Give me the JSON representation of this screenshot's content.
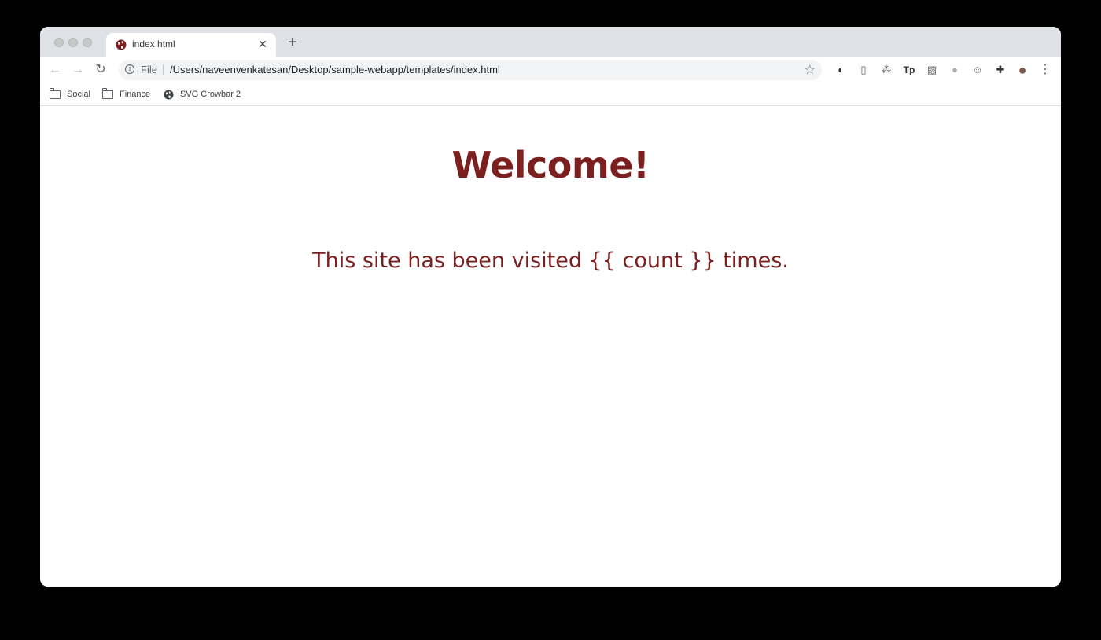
{
  "browser": {
    "tab": {
      "title": "index.html",
      "favicon": "globe-icon",
      "close_glyph": "✕"
    },
    "new_tab_glyph": "+",
    "nav": {
      "back_glyph": "←",
      "forward_glyph": "→",
      "reload_glyph": "↻"
    },
    "omnibox": {
      "scheme_label": "File",
      "url": "/Users/naveenvenkatesan/Desktop/sample-webapp/templates/index.html",
      "info_glyph": "i",
      "star_glyph": "☆"
    },
    "extensions": [
      {
        "icon": "shield-extension-icon",
        "glyph": "◐"
      },
      {
        "icon": "document-extension-icon",
        "glyph": "▯"
      },
      {
        "icon": "translate-extension-icon",
        "glyph": "⁂"
      },
      {
        "icon": "tp-extension-icon",
        "glyph": "Tp"
      },
      {
        "icon": "grid-extension-icon",
        "glyph": "▧"
      },
      {
        "icon": "circle-extension-icon",
        "glyph": "●"
      },
      {
        "icon": "face-extension-icon",
        "glyph": "☺"
      },
      {
        "icon": "puzzle-extension-icon",
        "glyph": "✚"
      },
      {
        "icon": "profile-avatar-icon",
        "glyph": "●"
      }
    ],
    "menu_glyph": "⋮",
    "bookmarks": [
      {
        "label": "Social",
        "icon": "folder-icon"
      },
      {
        "label": "Finance",
        "icon": "folder-icon"
      },
      {
        "label": "SVG Crowbar 2",
        "icon": "globe-icon"
      }
    ]
  },
  "page": {
    "heading": "Welcome!",
    "visit_text": "This site has been visited {{ count }} times."
  },
  "colors": {
    "accent": "#7b1f1f",
    "tabstrip": "#dee1e6",
    "omnibox": "#f1f3f4"
  }
}
